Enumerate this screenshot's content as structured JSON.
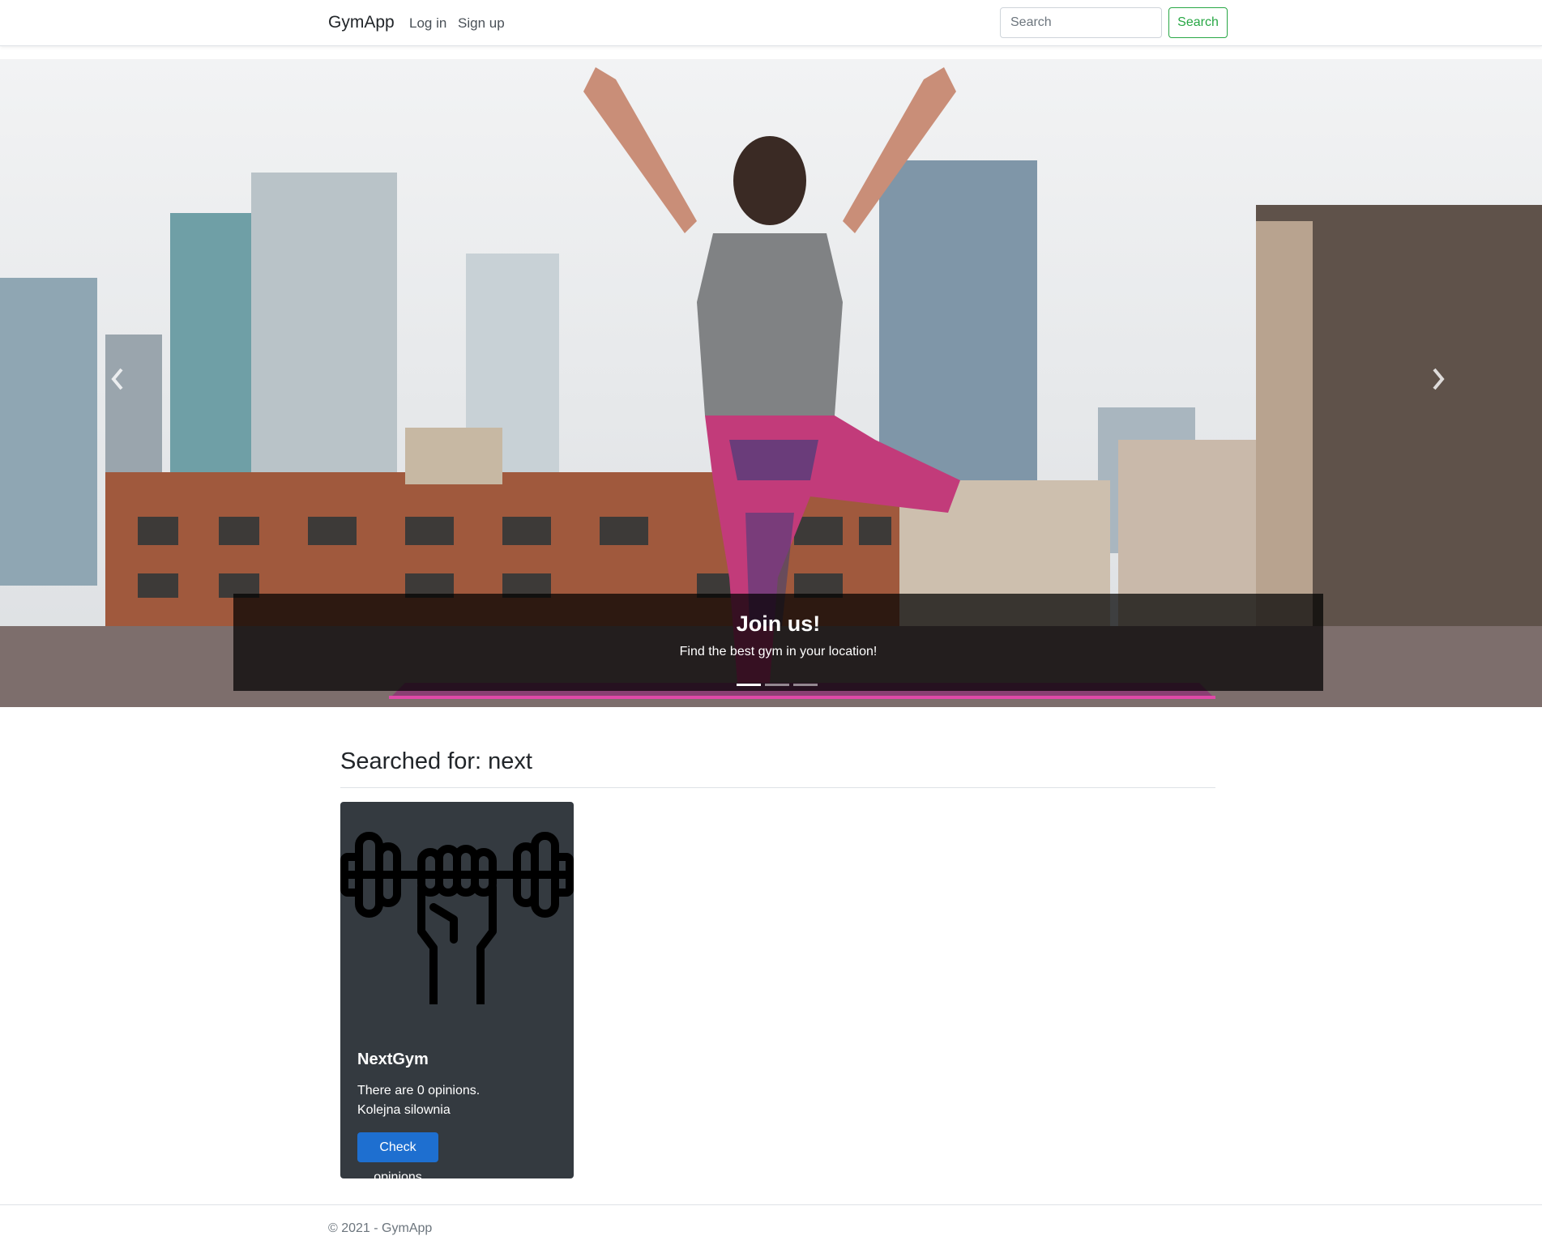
{
  "navbar": {
    "brand": "GymApp",
    "login_label": "Log in",
    "signup_label": "Sign up",
    "search_placeholder": "Search",
    "search_button": "Search"
  },
  "carousel": {
    "caption_title": "Join us!",
    "caption_text": "Find the best gym in your location!",
    "slide_count": 3,
    "active_slide": 1
  },
  "results": {
    "heading": "Searched for: next",
    "cards": [
      {
        "title": "NextGym",
        "opinions_text": "There are 0 opinions.",
        "description": "Kolejna silownia",
        "button_label": "Check opinions",
        "image_icon": "dumbbell-fist-icon"
      }
    ]
  },
  "footer": {
    "text": "© 2021 - GymApp"
  },
  "colors": {
    "search_button": "#28a745",
    "card_background": "#343a40",
    "primary_button": "#1e6fd0"
  }
}
